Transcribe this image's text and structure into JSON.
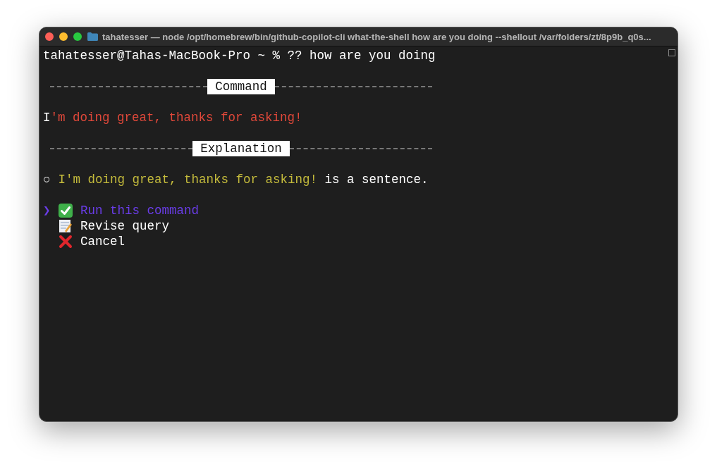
{
  "window": {
    "title": "tahatesser — node /opt/homebrew/bin/github-copilot-cli what-the-shell how are you doing --shellout /var/folders/zt/8p9b_q0s..."
  },
  "prompt": "tahatesser@Tahas-MacBook-Pro ~ % ?? how are you doing",
  "command_header": "Command",
  "command": "I'm doing great, thanks for asking!",
  "explanation_header": "Explanation",
  "explanation": {
    "bullet": "○",
    "quote": "I'm doing great, thanks for asking!",
    "rest": "is a sentence."
  },
  "pointer": "❯",
  "menu": [
    {
      "kind": "check",
      "label": "Run this command",
      "selected": true
    },
    {
      "kind": "memo",
      "label": "Revise query",
      "selected": false
    },
    {
      "kind": "cross",
      "label": "Cancel",
      "selected": false
    }
  ]
}
